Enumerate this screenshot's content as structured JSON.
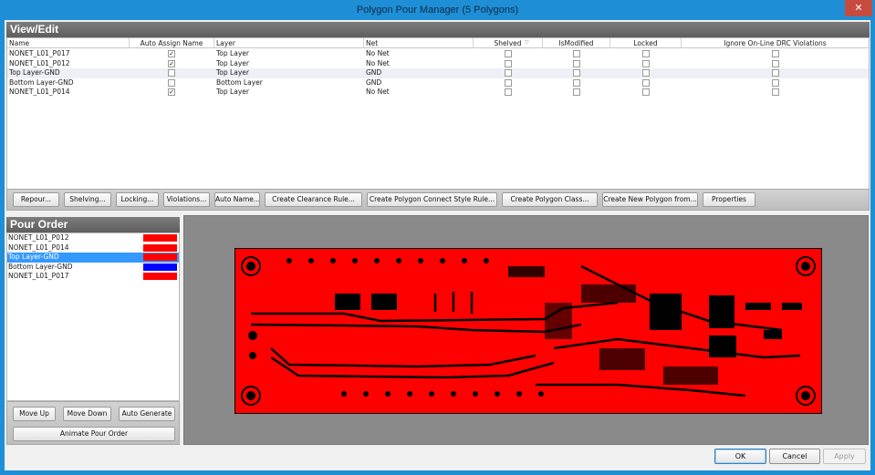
{
  "window": {
    "title": "Polygon Pour Manager (5 Polygons)",
    "close_icon": "✕"
  },
  "view_edit": {
    "header": "View/Edit",
    "columns": [
      "Name",
      "Auto Assign Name",
      "Layer",
      "Net",
      "Shelved",
      "IsModified",
      "Locked",
      "Ignore On-Line DRC Violations"
    ],
    "rows": [
      {
        "name": "NONET_L01_P017",
        "auto_assign": "✓",
        "layer": "Top Layer",
        "net": "No Net",
        "shelved": "",
        "modified": "",
        "locked": "",
        "ignore_drc": ""
      },
      {
        "name": "NONET_L01_P012",
        "auto_assign": "✓",
        "layer": "Top Layer",
        "net": "No Net",
        "shelved": "",
        "modified": "",
        "locked": "",
        "ignore_drc": ""
      },
      {
        "name": "Top Layer-GND",
        "auto_assign": "",
        "layer": "Top Layer",
        "net": "GND",
        "shelved": "",
        "modified": "",
        "locked": "",
        "ignore_drc": ""
      },
      {
        "name": "Bottom Layer-GND",
        "auto_assign": "",
        "layer": "Bottom Layer",
        "net": "GND",
        "shelved": "",
        "modified": "",
        "locked": "",
        "ignore_drc": ""
      },
      {
        "name": "NONET_L01_P014",
        "auto_assign": "✓",
        "layer": "Top Layer",
        "net": "No Net",
        "shelved": "",
        "modified": "",
        "locked": "",
        "ignore_drc": ""
      }
    ],
    "buttons": [
      "Repour...",
      "Shelving...",
      "Locking...",
      "Violations...",
      "Auto Name...",
      "Create Clearance Rule...",
      "Create Polygon Connect Style Rule...",
      "Create Polygon Class...",
      "Create New Polygon from...",
      "Properties"
    ]
  },
  "pour_order": {
    "header": "Pour Order",
    "items": [
      {
        "name": "NONET_L01_P012",
        "color": "#FF0000"
      },
      {
        "name": "NONET_L01_P014",
        "color": "#FF0000"
      },
      {
        "name": "Top Layer-GND",
        "color": "#FF0000"
      },
      {
        "name": "Bottom Layer-GND",
        "color": "#0000FF"
      },
      {
        "name": "NONET_L01_P017",
        "color": "#FF0000"
      }
    ],
    "selected_index": 2,
    "buttons": {
      "move_up": "Move Up",
      "move_down": "Move Down",
      "auto_generate": "Auto Generate",
      "animate": "Animate Pour Order"
    }
  },
  "footer": {
    "ok": "OK",
    "cancel": "Cancel",
    "apply": "Apply"
  },
  "colors": {
    "accent": "#1E8FD6",
    "selection": "#3399FF",
    "copper_top": "#FF0000",
    "copper_bottom": "#0000FF",
    "board_outline": "#000000",
    "preview_bg": "#8A8A8A"
  }
}
